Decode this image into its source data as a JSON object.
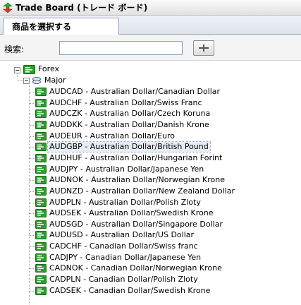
{
  "window": {
    "title": "Trade Board (トレード ボード)",
    "icon": "arrows-icon"
  },
  "tabs": [
    {
      "label": "商品を選択する",
      "active": true
    }
  ],
  "search": {
    "label": "検索:",
    "value": "",
    "placeholder": "",
    "button_icon": "add-icon"
  },
  "tree": {
    "root": {
      "label": "Forex",
      "expanded": true,
      "icon": "forex-folder-icon"
    },
    "group": {
      "label": "Major",
      "expanded": true,
      "icon": "major-group-icon"
    },
    "items": [
      {
        "label": "AUDCAD - Australian Dollar/Canadian Dollar",
        "selected": false
      },
      {
        "label": "AUDCHF - Australian Dollar/Swiss Franc",
        "selected": false
      },
      {
        "label": "AUDCZK - Australian Dollar/Czech Koruna",
        "selected": false
      },
      {
        "label": "AUDDKK - Australian Dollar/Danish Krone",
        "selected": false
      },
      {
        "label": "AUDEUR - Australian Dollar/Euro",
        "selected": false
      },
      {
        "label": "AUDGBP - Australian Dollar/British Pound",
        "selected": true
      },
      {
        "label": "AUDHUF - Australian Dollar/Hungarian Forint",
        "selected": false
      },
      {
        "label": "AUDJPY - Australian Dollar/Japanese Yen",
        "selected": false
      },
      {
        "label": "AUDNOK - Australian Dollar/Norwegian Krone",
        "selected": false
      },
      {
        "label": "AUDNZD - Australian Dollar/New Zealand Dollar",
        "selected": false
      },
      {
        "label": "AUDPLN - Australian Dollar/Polish Zloty",
        "selected": false
      },
      {
        "label": "AUDSEK - Australian Dollar/Swedish Krone",
        "selected": false
      },
      {
        "label": "AUDSGD - Australian Dollar/Singapore Dollar",
        "selected": false
      },
      {
        "label": "AUDUSD - Australian Dollar/US Dollar",
        "selected": false
      },
      {
        "label": "CADCHF - Canadian Dollar/Swiss franc",
        "selected": false
      },
      {
        "label": "CADJPY - Canadian Dollar/Japanese Yen",
        "selected": false
      },
      {
        "label": "CADNOK - Canadian Dollar/Norwegian Krone",
        "selected": false
      },
      {
        "label": "CADPLN - Canadian Dollar/Polish Zloty",
        "selected": false
      },
      {
        "label": "CADSEK - Canadian Dollar/Swedish Krone",
        "selected": false
      }
    ]
  },
  "colors": {
    "icon_green": "#2e9a2e",
    "icon_green_dark": "#1c6e1c",
    "selection_bg": "#e8edf5",
    "tab_border": "#9aa6b5"
  }
}
